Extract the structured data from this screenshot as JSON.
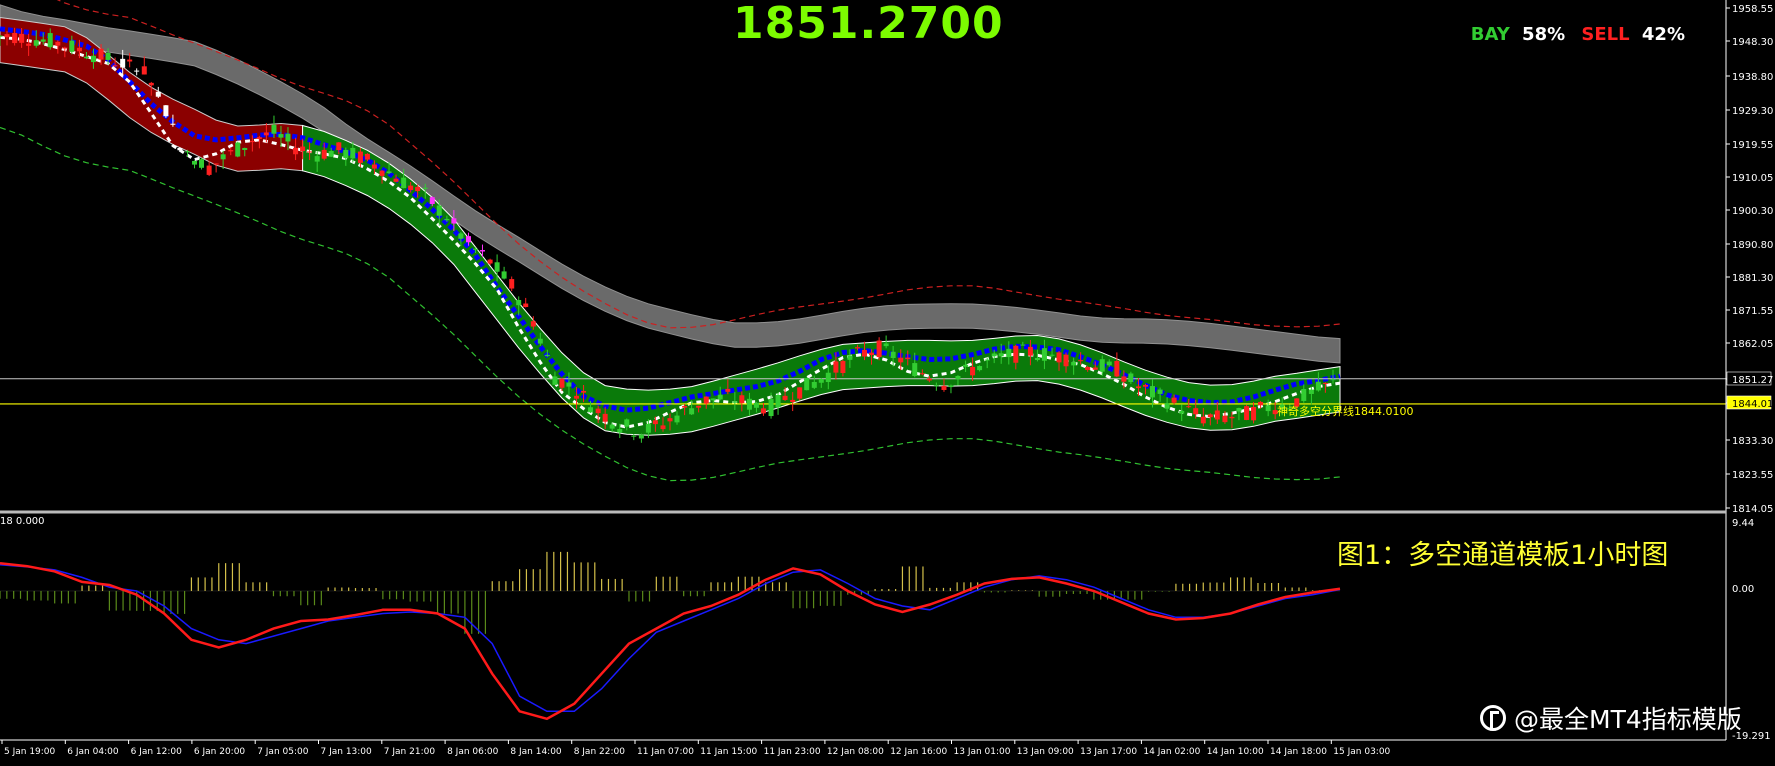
{
  "header": {
    "price": "1851.2700",
    "bay_label": "BAY",
    "bay_pct": "58%",
    "sell_label": "SELL",
    "sell_pct": "42%"
  },
  "caption": "图1：多空通道模板1小时图",
  "watermark": "@最全MT4指标模版",
  "boundary_label": "神奇多空分界线1844.0100",
  "macd_label": "18 0.000",
  "colors": {
    "background": "#000000",
    "bull_candle": "#32cd32",
    "bear_candle": "#ff2020",
    "channel_green": "#0a7a0a",
    "channel_red": "#8b0000",
    "gray_band": "#707070",
    "blue_line": "#0000ff",
    "bay": "#32cd32",
    "sell": "#ff2020",
    "caption": "#ffff33"
  },
  "chart_data": [
    {
      "type": "candlestick",
      "panel": "price",
      "ylim": [
        1814.05,
        1958.55
      ],
      "y_ticks": [
        "1958.55",
        "1948.30",
        "1938.80",
        "1929.30",
        "1919.55",
        "1910.05",
        "1900.30",
        "1890.80",
        "1881.30",
        "1871.55",
        "1862.05",
        "1851.27",
        "1844.01",
        "1833.30",
        "1823.55",
        "1814.05"
      ],
      "x_ticks": [
        "5 Jan 19:00",
        "6 Jan 04:00",
        "6 Jan 12:00",
        "6 Jan 20:00",
        "7 Jan 05:00",
        "7 Jan 13:00",
        "7 Jan 21:00",
        "8 Jan 06:00",
        "8 Jan 14:00",
        "8 Jan 22:00",
        "11 Jan 07:00",
        "11 Jan 15:00",
        "11 Jan 23:00",
        "12 Jan 08:00",
        "12 Jan 16:00",
        "13 Jan 01:00",
        "13 Jan 09:00",
        "13 Jan 17:00",
        "14 Jan 02:00",
        "14 Jan 10:00",
        "14 Jan 18:00",
        "15 Jan 03:00"
      ],
      "current_price": 1851.27,
      "boundary_price": 1844.01,
      "close_path": [
        1950,
        1949,
        1948,
        1946,
        1944,
        1942,
        1940,
        1928,
        1915,
        1912,
        1916,
        1920,
        1922,
        1918,
        1916,
        1917,
        1915,
        1912,
        1908,
        1904,
        1898,
        1890,
        1885,
        1878,
        1868,
        1852,
        1848,
        1842,
        1838,
        1836,
        1838,
        1842,
        1845,
        1846,
        1844,
        1843,
        1847,
        1850,
        1854,
        1858,
        1860,
        1857,
        1853,
        1850,
        1853,
        1856,
        1858,
        1859,
        1858,
        1857,
        1855,
        1854,
        1849,
        1846,
        1843,
        1840,
        1840,
        1841,
        1843,
        1844,
        1847,
        1850,
        1850
      ]
    },
    {
      "type": "line",
      "panel": "macd",
      "ylim": [
        -19.291,
        9.44
      ],
      "y_ticks": [
        "9.44",
        "0.00",
        "-19.291"
      ],
      "series": [
        {
          "values": [
            3.5,
            3.2,
            2.8,
            1.8,
            0.5,
            0,
            -2,
            -5,
            -6.5,
            -7,
            -6,
            -5,
            -4,
            -3.5,
            -3,
            -2.8,
            -3,
            -3.5,
            -7,
            -14,
            -16,
            -16,
            -13,
            -9,
            -5.5,
            -4,
            -2.5,
            -1,
            1,
            2.5,
            2.8,
            1,
            -1,
            -2,
            -2.5,
            -1,
            0.5,
            1.5,
            2,
            1.5,
            0.5,
            -1,
            -2.5,
            -3.5,
            -3.5,
            -3,
            -2,
            -1,
            -0.5,
            0.2
          ]
        },
        {
          "values": [
            3.7,
            3.3,
            2.6,
            1.2,
            0.8,
            -0.5,
            -3,
            -6.5,
            -7.5,
            -6.5,
            -5,
            -4,
            -3.8,
            -3.2,
            -2.5,
            -2.5,
            -3,
            -5,
            -11,
            -16,
            -17,
            -15,
            -11,
            -7,
            -5,
            -3,
            -2,
            -0.5,
            1.5,
            3,
            2.2,
            0,
            -1.8,
            -2.8,
            -1.8,
            -0.5,
            1,
            1.6,
            1.8,
            1,
            0,
            -1.5,
            -3,
            -3.8,
            -3.6,
            -3,
            -1.8,
            -0.8,
            -0.2,
            0.3
          ]
        }
      ]
    }
  ]
}
